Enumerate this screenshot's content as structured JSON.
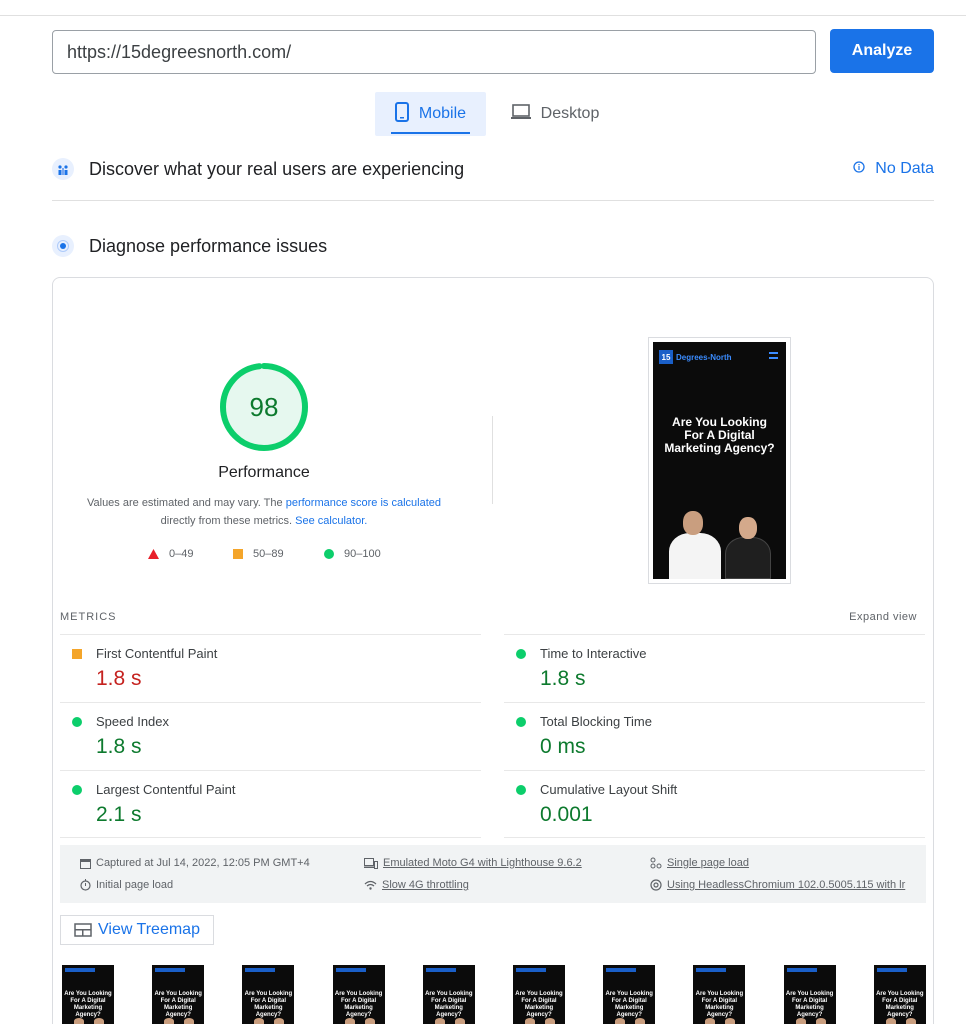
{
  "search": {
    "url": "https://15degreesnorth.com/",
    "analyze_label": "Analyze"
  },
  "tabs": [
    {
      "label": "Mobile",
      "active": true
    },
    {
      "label": "Desktop",
      "active": false
    }
  ],
  "field_data": {
    "title": "Discover what your real users are experiencing",
    "status": "No Data"
  },
  "lab_data": {
    "title": "Diagnose performance issues"
  },
  "performance": {
    "score": "98",
    "score_fraction": 0.98,
    "label": "Performance",
    "note_1": "Values are estimated and may vary. The ",
    "note_link_1": "performance score is calculated",
    "note_2": "directly from these metrics. ",
    "note_link_2": "See calculator."
  },
  "legend": [
    {
      "range": "0–49",
      "shape": "triangle",
      "color": "#e8202a"
    },
    {
      "range": "50–89",
      "shape": "square",
      "color": "#f4a52a"
    },
    {
      "range": "90–100",
      "shape": "circle",
      "color": "#0cce6b"
    }
  ],
  "screenshot": {
    "logo": "15",
    "brand": "Degrees-North",
    "headline": "Are You Looking For A Digital Marketing Agency?"
  },
  "metrics": {
    "heading": "METRICS",
    "expand_label": "Expand view",
    "items": [
      {
        "label": "First Contentful Paint",
        "value": "1.8 s",
        "rating": "average",
        "color": "#c5221f"
      },
      {
        "label": "Time to Interactive",
        "value": "1.8 s",
        "rating": "good",
        "color": "#0d7a2e"
      },
      {
        "label": "Speed Index",
        "value": "1.8 s",
        "rating": "good",
        "color": "#0d7a2e"
      },
      {
        "label": "Total Blocking Time",
        "value": "0 ms",
        "rating": "good",
        "color": "#0d7a2e"
      },
      {
        "label": "Largest Contentful Paint",
        "value": "2.1 s",
        "rating": "good",
        "color": "#0d7a2e"
      },
      {
        "label": "Cumulative Layout Shift",
        "value": "0.001",
        "rating": "good",
        "color": "#0d7a2e"
      }
    ]
  },
  "run_info": {
    "captured": "Captured at Jul 14, 2022, 12:05 PM GMT+4",
    "initial": "Initial page load",
    "device": "Emulated Moto G4 with Lighthouse 9.6.2",
    "throttling": "Slow 4G throttling",
    "single_page": "Single page load",
    "browser": "Using HeadlessChromium 102.0.5005.115 with lr"
  },
  "treemap": {
    "label": "View Treemap"
  },
  "filmstrip": {
    "count": 10,
    "thumb_text": "Are You Looking For A Digital Marketing Agency?"
  },
  "colors": {
    "accent": "#1a73e8",
    "pass": "#0cce6b",
    "average": "#f4a52a",
    "fail": "#e8202a"
  }
}
